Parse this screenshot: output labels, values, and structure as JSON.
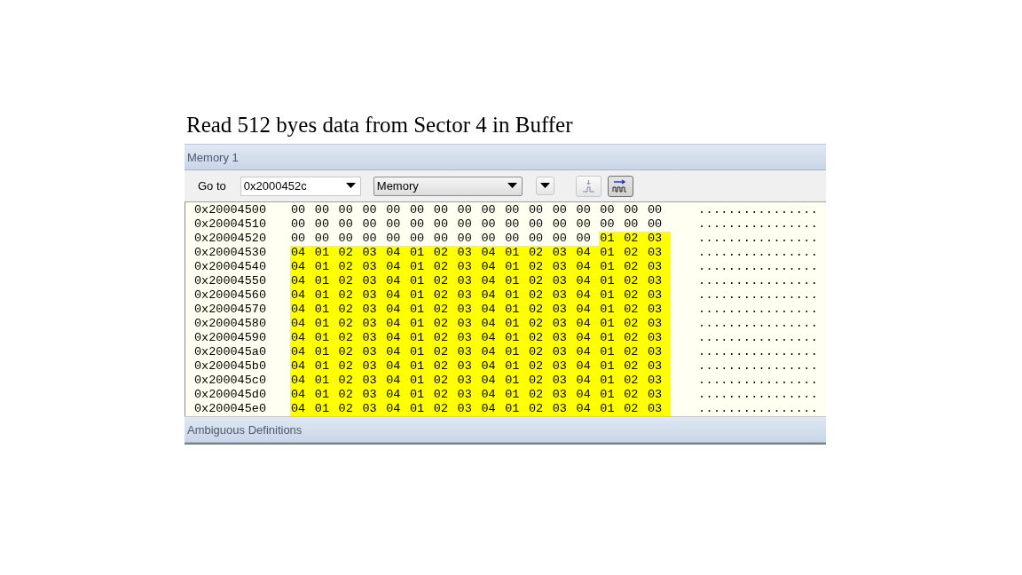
{
  "heading": "Read 512 byes data from Sector 4 in Buffer",
  "panel": {
    "title": "Memory 1"
  },
  "toolbar": {
    "goto_label": "Go to",
    "address_field": {
      "value": "0x2000452c"
    },
    "view_combo": {
      "value": "Memory"
    },
    "tool_buttons": [
      {
        "kind": "menu",
        "pressed": false
      },
      {
        "kind": "single-step",
        "pressed": false
      },
      {
        "kind": "continuous",
        "pressed": true
      }
    ]
  },
  "rows": [
    {
      "address": "0x20004500",
      "bytes": [
        "00",
        "00",
        "00",
        "00",
        "00",
        "00",
        "00",
        "00",
        "00",
        "00",
        "00",
        "00",
        "00",
        "00",
        "00",
        "00"
      ],
      "highlighted_bytes": [],
      "ascii": "................"
    },
    {
      "address": "0x20004510",
      "bytes": [
        "00",
        "00",
        "00",
        "00",
        "00",
        "00",
        "00",
        "00",
        "00",
        "00",
        "00",
        "00",
        "00",
        "00",
        "00",
        "00"
      ],
      "highlighted_bytes": [],
      "ascii": "................"
    },
    {
      "address": "0x20004520",
      "bytes": [
        "00",
        "00",
        "00",
        "00",
        "00",
        "00",
        "00",
        "00",
        "00",
        "00",
        "00",
        "00",
        "00"
      ],
      "highlighted_bytes": [
        "01",
        "02",
        "03"
      ],
      "ascii": "................"
    },
    {
      "address": "0x20004530",
      "bytes": [],
      "highlighted_bytes": [
        "04",
        "01",
        "02",
        "03",
        "04",
        "01",
        "02",
        "03",
        "04",
        "01",
        "02",
        "03",
        "04",
        "01",
        "02",
        "03"
      ],
      "ascii": "................"
    },
    {
      "address": "0x20004540",
      "bytes": [],
      "highlighted_bytes": [
        "04",
        "01",
        "02",
        "03",
        "04",
        "01",
        "02",
        "03",
        "04",
        "01",
        "02",
        "03",
        "04",
        "01",
        "02",
        "03"
      ],
      "ascii": "................"
    },
    {
      "address": "0x20004550",
      "bytes": [],
      "highlighted_bytes": [
        "04",
        "01",
        "02",
        "03",
        "04",
        "01",
        "02",
        "03",
        "04",
        "01",
        "02",
        "03",
        "04",
        "01",
        "02",
        "03"
      ],
      "ascii": "................"
    },
    {
      "address": "0x20004560",
      "bytes": [],
      "highlighted_bytes": [
        "04",
        "01",
        "02",
        "03",
        "04",
        "01",
        "02",
        "03",
        "04",
        "01",
        "02",
        "03",
        "04",
        "01",
        "02",
        "03"
      ],
      "ascii": "................"
    },
    {
      "address": "0x20004570",
      "bytes": [],
      "highlighted_bytes": [
        "04",
        "01",
        "02",
        "03",
        "04",
        "01",
        "02",
        "03",
        "04",
        "01",
        "02",
        "03",
        "04",
        "01",
        "02",
        "03"
      ],
      "ascii": "................"
    },
    {
      "address": "0x20004580",
      "bytes": [],
      "highlighted_bytes": [
        "04",
        "01",
        "02",
        "03",
        "04",
        "01",
        "02",
        "03",
        "04",
        "01",
        "02",
        "03",
        "04",
        "01",
        "02",
        "03"
      ],
      "ascii": "................"
    },
    {
      "address": "0x20004590",
      "bytes": [],
      "highlighted_bytes": [
        "04",
        "01",
        "02",
        "03",
        "04",
        "01",
        "02",
        "03",
        "04",
        "01",
        "02",
        "03",
        "04",
        "01",
        "02",
        "03"
      ],
      "ascii": "................"
    },
    {
      "address": "0x200045a0",
      "bytes": [],
      "highlighted_bytes": [
        "04",
        "01",
        "02",
        "03",
        "04",
        "01",
        "02",
        "03",
        "04",
        "01",
        "02",
        "03",
        "04",
        "01",
        "02",
        "03"
      ],
      "ascii": "................"
    },
    {
      "address": "0x200045b0",
      "bytes": [],
      "highlighted_bytes": [
        "04",
        "01",
        "02",
        "03",
        "04",
        "01",
        "02",
        "03",
        "04",
        "01",
        "02",
        "03",
        "04",
        "01",
        "02",
        "03"
      ],
      "ascii": "................"
    },
    {
      "address": "0x200045c0",
      "bytes": [],
      "highlighted_bytes": [
        "04",
        "01",
        "02",
        "03",
        "04",
        "01",
        "02",
        "03",
        "04",
        "01",
        "02",
        "03",
        "04",
        "01",
        "02",
        "03"
      ],
      "ascii": "................"
    },
    {
      "address": "0x200045d0",
      "bytes": [],
      "highlighted_bytes": [
        "04",
        "01",
        "02",
        "03",
        "04",
        "01",
        "02",
        "03",
        "04",
        "01",
        "02",
        "03",
        "04",
        "01",
        "02",
        "03"
      ],
      "ascii": "................"
    },
    {
      "address": "0x200045e0",
      "bytes": [],
      "highlighted_bytes": [
        "04",
        "01",
        "02",
        "03",
        "04",
        "01",
        "02",
        "03",
        "04",
        "01",
        "02",
        "03",
        "04",
        "01",
        "02",
        "03"
      ],
      "ascii": "................"
    }
  ],
  "footer_panel": {
    "title": "Ambiguous Definitions"
  }
}
